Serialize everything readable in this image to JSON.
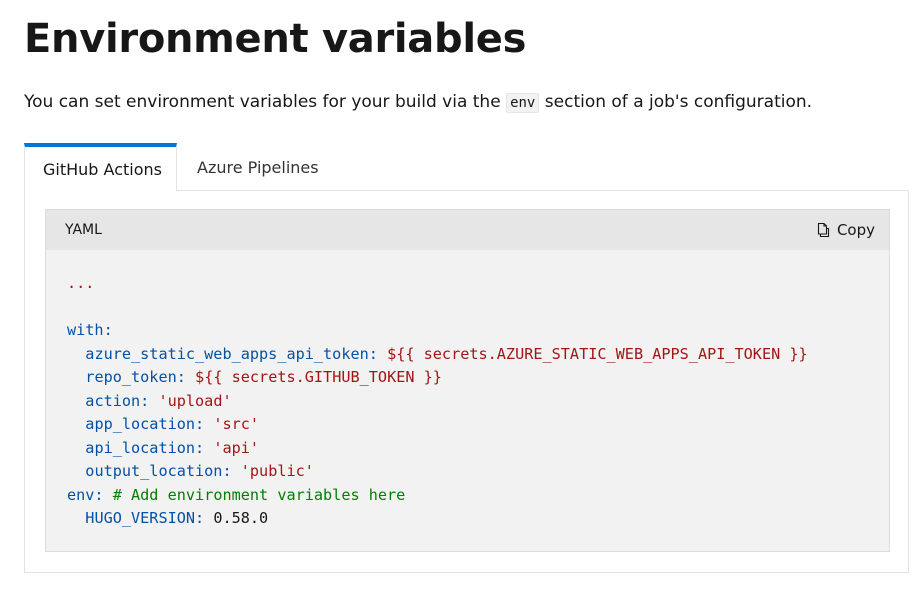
{
  "page": {
    "title": "Environment variables",
    "intro_before": "You can set environment variables for your build via the ",
    "intro_code": "env",
    "intro_after": " section of a job's configuration."
  },
  "tabs": [
    {
      "label": "GitHub Actions",
      "active": true
    },
    {
      "label": "Azure Pipelines",
      "active": false
    }
  ],
  "code_block": {
    "language": "YAML",
    "copy_label": "Copy",
    "copy_icon": "copy-icon",
    "lines": {
      "l1": {
        "value": "..."
      },
      "l3": {
        "key": "with:"
      },
      "l4": {
        "indent": "  ",
        "key": "azure_static_web_apps_api_token:",
        "value": "${{ secrets.AZURE_STATIC_WEB_APPS_API_TOKEN }}"
      },
      "l5": {
        "indent": "  ",
        "key": "repo_token:",
        "value": "${{ secrets.GITHUB_TOKEN }}"
      },
      "l6": {
        "indent": "  ",
        "key": "action:",
        "value": "'upload'"
      },
      "l7": {
        "indent": "  ",
        "key": "app_location:",
        "value": "'src'"
      },
      "l8": {
        "indent": "  ",
        "key": "api_location:",
        "value": "'api'"
      },
      "l9": {
        "indent": "  ",
        "key": "output_location:",
        "value": "'public'"
      },
      "l10": {
        "key": "env:",
        "comment": "# Add environment variables here"
      },
      "l11": {
        "indent": "  ",
        "key": "HUGO_VERSION:",
        "value": "0.58.0"
      }
    }
  },
  "colors": {
    "tab_accent": "#0078d4",
    "yaml_key": "#0451a5",
    "yaml_string": "#a31515",
    "yaml_comment": "#008000"
  }
}
